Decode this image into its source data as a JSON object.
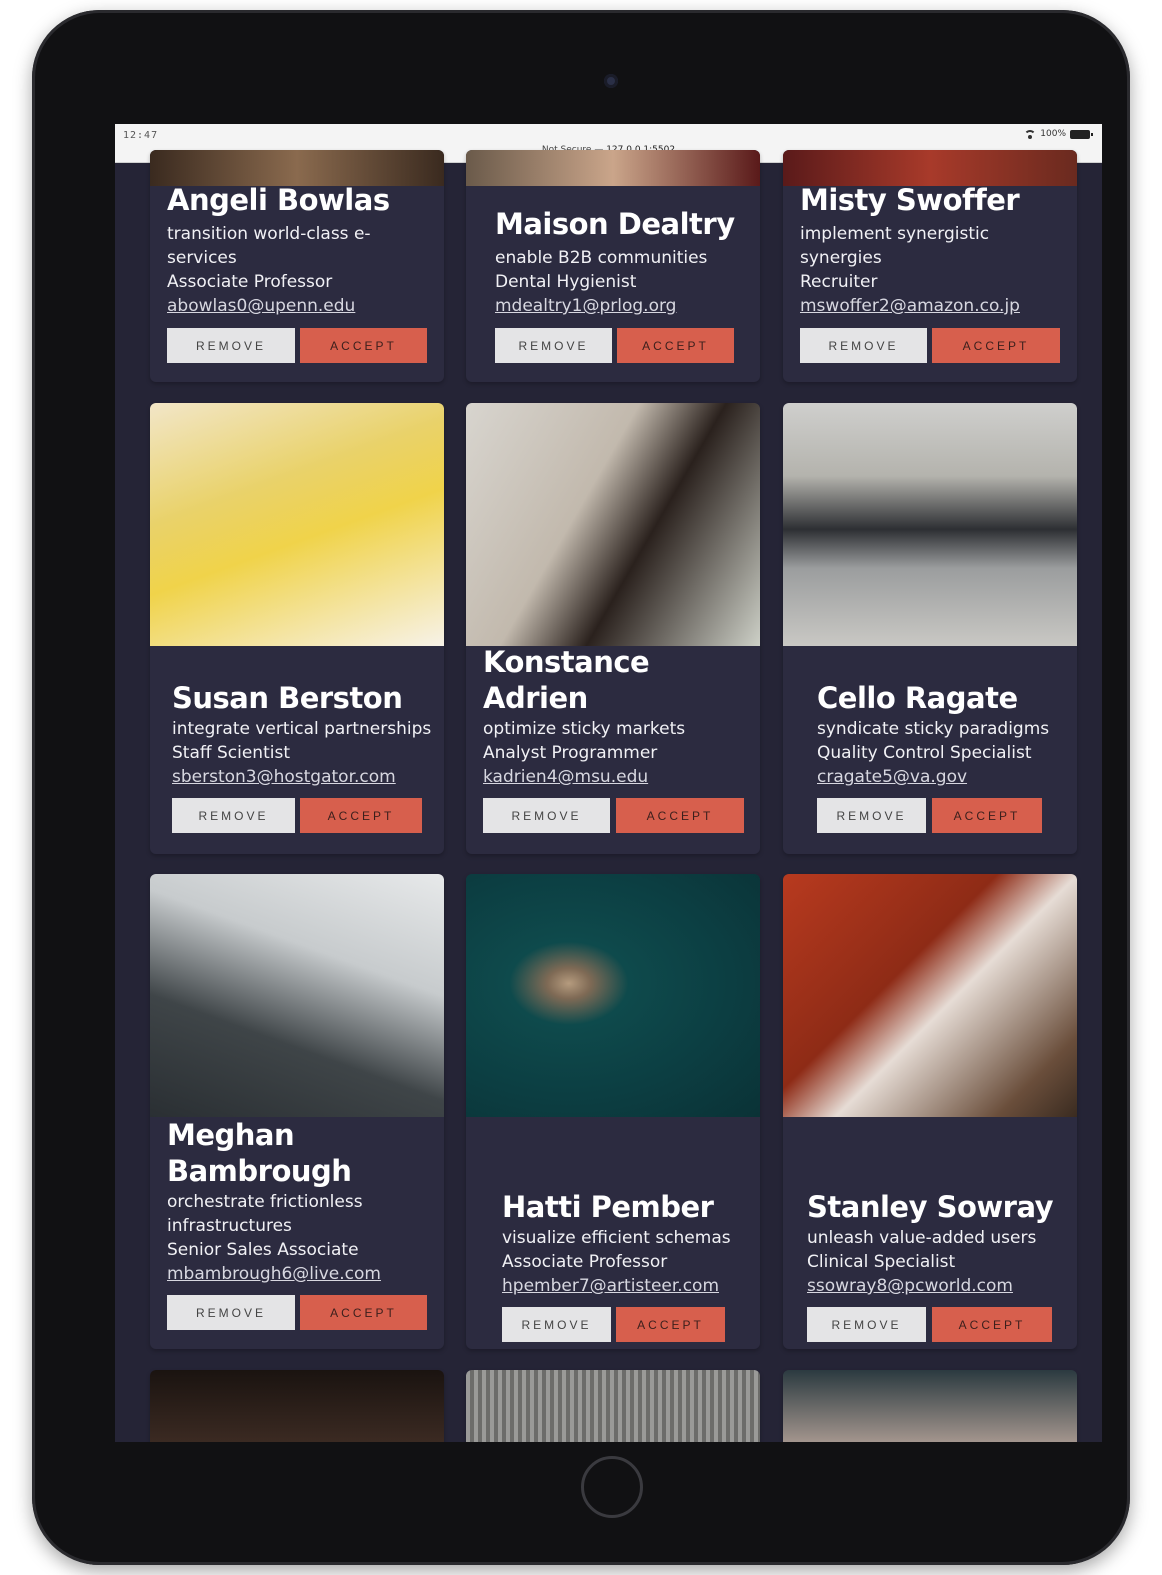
{
  "status": {
    "time": "12:47",
    "battery": "100%",
    "url_prefix": "Not Secure —",
    "url_host": "127.0.0.1:5502"
  },
  "buttons": {
    "remove": "REMOVE",
    "accept": "ACCEPT"
  },
  "cards": [
    {
      "name": "Angeli Bowlas",
      "tagline_1": "transition world-class e-",
      "tagline_2": "services",
      "title": "Associate Professor",
      "email": "abowlas0@upenn.edu"
    },
    {
      "name": "Maison Dealtry",
      "tagline_1": "enable B2B communities",
      "title": "Dental Hygienist",
      "email": "mdealtry1@prlog.org"
    },
    {
      "name": "Misty Swoffer",
      "tagline_1": "implement synergistic",
      "tagline_2": "synergies",
      "title": "Recruiter",
      "email": "mswoffer2@amazon.co.jp"
    },
    {
      "name": "Susan Berston",
      "tagline_1": "integrate vertical partnerships",
      "title": "Staff Scientist",
      "email": "sberston3@hostgator.com"
    },
    {
      "name_1": "Konstance",
      "name_2": "Adrien",
      "tagline_1": "optimize sticky markets",
      "title": "Analyst Programmer",
      "email": "kadrien4@msu.edu"
    },
    {
      "name": "Cello Ragate",
      "tagline_1": "syndicate sticky paradigms",
      "title": "Quality Control Specialist",
      "email": "cragate5@va.gov"
    },
    {
      "name_1": "Meghan",
      "name_2": "Bambrough",
      "tagline_1": "orchestrate frictionless",
      "tagline_2": "infrastructures",
      "title": "Senior Sales Associate",
      "email": "mbambrough6@live.com"
    },
    {
      "name": "Hatti Pember",
      "tagline_1": "visualize efficient schemas",
      "title": "Associate Professor",
      "email": "hpember7@artisteer.com"
    },
    {
      "name": "Stanley Sowray",
      "tagline_1": "unleash value-added users",
      "title": "Clinical Specialist",
      "email": "ssowray8@pcworld.com"
    }
  ],
  "colors": {
    "page_bg": "#252436",
    "card_bg": "#2c2b40",
    "accept": "#d75f4d",
    "remove": "#e4e4e6"
  },
  "icons": [
    "wifi-icon",
    "battery-icon"
  ]
}
